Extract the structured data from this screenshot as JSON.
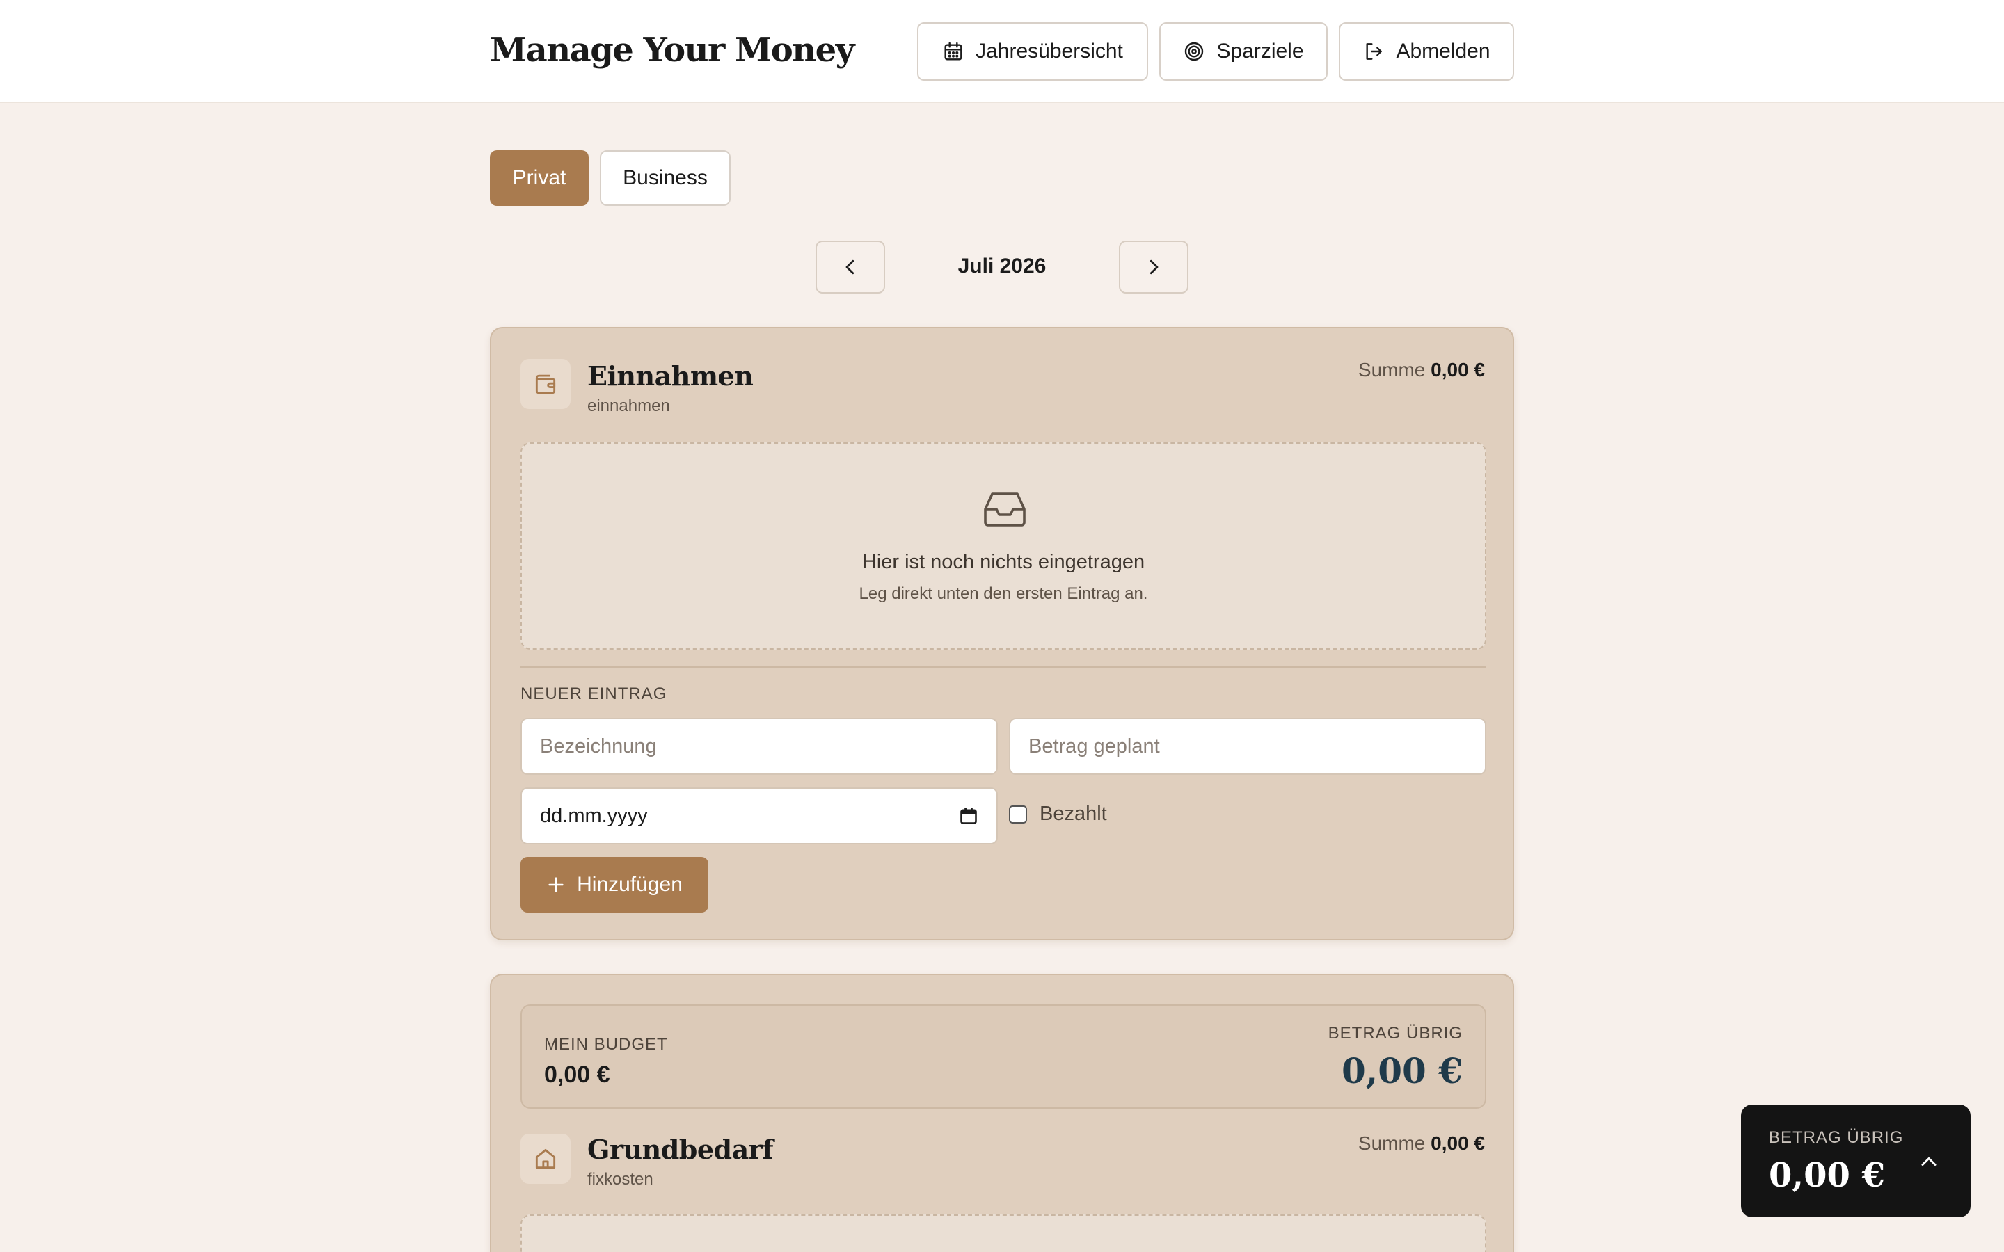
{
  "header": {
    "brand": "Manage Your Money",
    "nav": {
      "year_overview": "Jahresübersicht",
      "savings_goals": "Sparziele",
      "logout": "Abmelden"
    }
  },
  "tabs": [
    {
      "label": "Privat",
      "active": true
    },
    {
      "label": "Business",
      "active": false
    }
  ],
  "month": {
    "label": "Juli 2026"
  },
  "income": {
    "title": "Einnahmen",
    "subtitle": "einnahmen",
    "sum_label": "Summe",
    "sum_value": "0,00 €",
    "empty_title": "Hier ist noch nichts eingetragen",
    "empty_sub": "Leg direkt unten den ersten Eintrag an.",
    "form": {
      "heading": "NEUER EINTRAG",
      "name_placeholder": "Bezeichnung",
      "amount_placeholder": "Betrag geplant",
      "date_value": "dd.mm.yyyy",
      "paid_label": "Bezahlt",
      "paid_checked": false,
      "add_label": "Hinzufügen"
    }
  },
  "budget": {
    "label": "MEIN BUDGET",
    "value": "0,00 €",
    "remaining_label": "BETRAG ÜBRIG",
    "remaining_value": "0,00 €"
  },
  "grundbedarf": {
    "title": "Grundbedarf",
    "subtitle": "fixkosten",
    "sum_label": "Summe",
    "sum_value": "0,00 €"
  },
  "floating": {
    "label": "BETRAG ÜBRIG",
    "value": "0,00 €"
  },
  "colors": {
    "accent": "#a97b4f",
    "background": "#f7f0eb",
    "card": "#e0cfbe",
    "remaining": "#1f3a4a"
  }
}
